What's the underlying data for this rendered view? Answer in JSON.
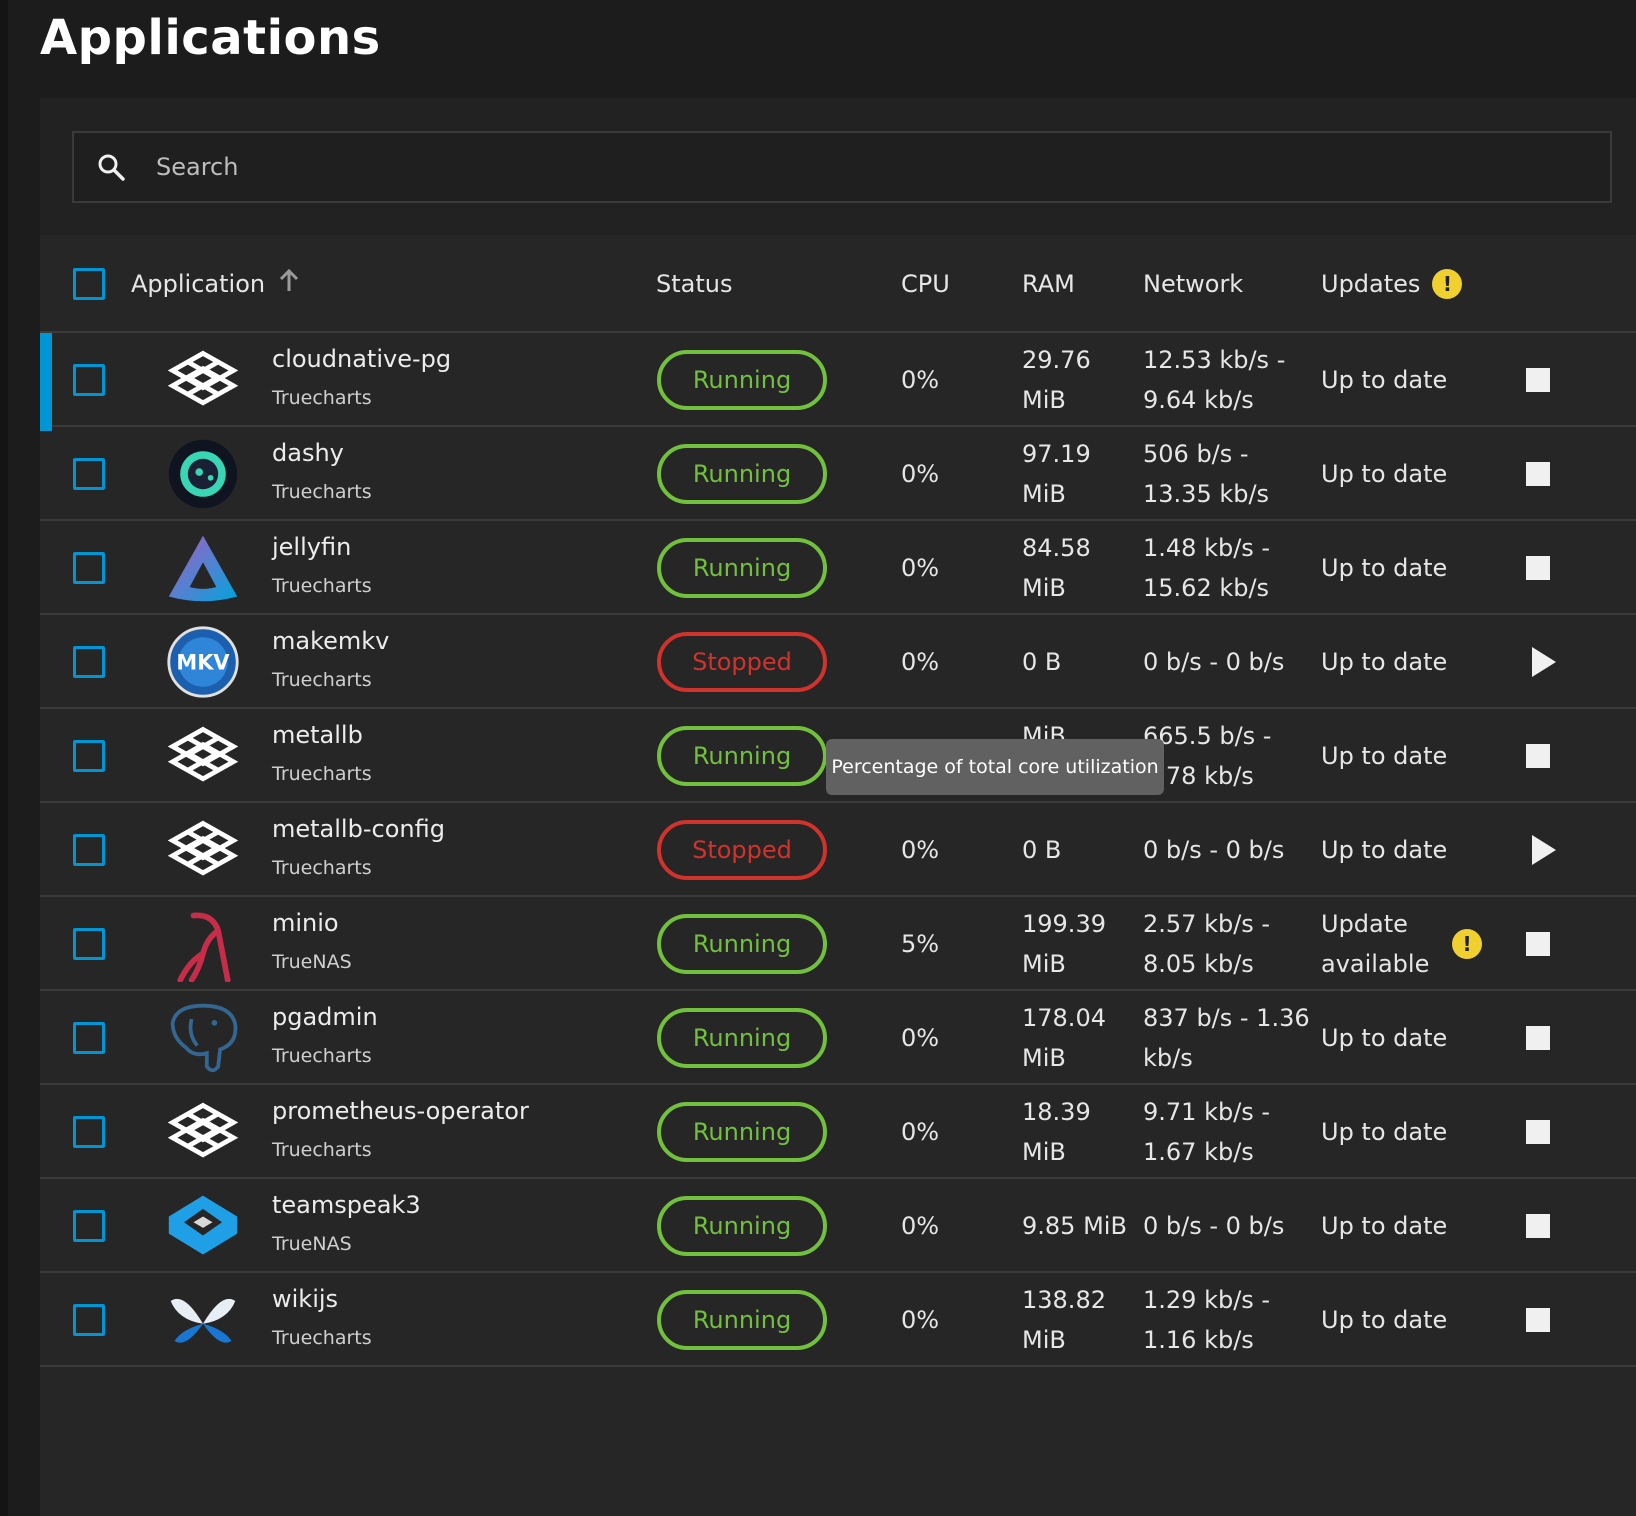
{
  "page": {
    "title": "Applications"
  },
  "search": {
    "placeholder": "Search",
    "value": ""
  },
  "table": {
    "headers": {
      "application": "Application",
      "status": "Status",
      "cpu": "CPU",
      "ram": "RAM",
      "network": "Network",
      "updates": "Updates"
    },
    "rows": [
      {
        "name": "cloudnative-pg",
        "train": "Truecharts",
        "logo": "truecharts-logo-icon",
        "status": "Running",
        "cpu": "0%",
        "ram": [
          "29.76",
          "MiB"
        ],
        "network": [
          "12.53 kb/s -",
          "9.64 kb/s"
        ],
        "updates": [
          "Up to date"
        ],
        "action": "stop-icon"
      },
      {
        "name": "dashy",
        "train": "Truecharts",
        "logo": "dashy-logo-icon",
        "status": "Running",
        "cpu": "0%",
        "ram": [
          "97.19",
          "MiB"
        ],
        "network": [
          "506 b/s -",
          "13.35 kb/s"
        ],
        "updates": [
          "Up to date"
        ],
        "action": "stop-icon"
      },
      {
        "name": "jellyfin",
        "train": "Truecharts",
        "logo": "jellyfin-logo-icon",
        "status": "Running",
        "cpu": "0%",
        "ram": [
          "84.58",
          "MiB"
        ],
        "network": [
          "1.48 kb/s -",
          "15.62 kb/s"
        ],
        "updates": [
          "Up to date"
        ],
        "action": "stop-icon"
      },
      {
        "name": "makemkv",
        "train": "Truecharts",
        "logo": "makemkv-logo-icon",
        "status": "Stopped",
        "cpu": "0%",
        "ram": [
          "0 B"
        ],
        "network": [
          "0 b/s - 0 b/s"
        ],
        "updates": [
          "Up to date"
        ],
        "action": "play-icon"
      },
      {
        "name": "metallb",
        "train": "Truecharts",
        "logo": "truecharts-logo-icon",
        "status": "Running",
        "cpu": "",
        "ram": [
          "",
          "MiB"
        ],
        "network": [
          "665.5 b/s -",
          "8.78 kb/s"
        ],
        "updates": [
          "Up to date"
        ],
        "action": "stop-icon"
      },
      {
        "name": "metallb-config",
        "train": "Truecharts",
        "logo": "truecharts-logo-icon",
        "status": "Stopped",
        "cpu": "0%",
        "ram": [
          "0 B"
        ],
        "network": [
          "0 b/s - 0 b/s"
        ],
        "updates": [
          "Up to date"
        ],
        "action": "play-icon"
      },
      {
        "name": "minio",
        "train": "TrueNAS",
        "logo": "minio-logo-icon",
        "status": "Running",
        "cpu": "5%",
        "ram": [
          "199.39",
          "MiB"
        ],
        "network": [
          "2.57 kb/s -",
          "8.05 kb/s"
        ],
        "updates": [
          "Update",
          "available"
        ],
        "update_warning": true,
        "action": "stop-icon"
      },
      {
        "name": "pgadmin",
        "train": "Truecharts",
        "logo": "postgres-elephant-logo-icon",
        "status": "Running",
        "cpu": "0%",
        "ram": [
          "178.04",
          "MiB"
        ],
        "network": [
          "837 b/s - 1.36",
          "kb/s"
        ],
        "updates": [
          "Up to date"
        ],
        "action": "stop-icon"
      },
      {
        "name": "prometheus-operator",
        "train": "Truecharts",
        "logo": "truecharts-logo-icon",
        "status": "Running",
        "cpu": "0%",
        "ram": [
          "18.39",
          "MiB"
        ],
        "network": [
          "9.71 kb/s -",
          "1.67 kb/s"
        ],
        "updates": [
          "Up to date"
        ],
        "action": "stop-icon"
      },
      {
        "name": "teamspeak3",
        "train": "TrueNAS",
        "logo": "teamspeak-logo-icon",
        "status": "Running",
        "cpu": "0%",
        "ram": [
          "9.85 MiB"
        ],
        "network": [
          "0 b/s - 0 b/s"
        ],
        "updates": [
          "Up to date"
        ],
        "action": "stop-icon"
      },
      {
        "name": "wikijs",
        "train": "Truecharts",
        "logo": "wikijs-logo-icon",
        "status": "Running",
        "cpu": "0%",
        "ram": [
          "138.82",
          "MiB"
        ],
        "network": [
          "1.29 kb/s -",
          "1.16 kb/s"
        ],
        "updates": [
          "Up to date"
        ],
        "action": "stop-icon"
      }
    ]
  },
  "tooltip": {
    "text": "Percentage of total core utilization"
  },
  "colors": {
    "accent": "#0095d5",
    "running": "#71c13c",
    "stopped": "#d1322b",
    "warning": "#f0d02e"
  }
}
